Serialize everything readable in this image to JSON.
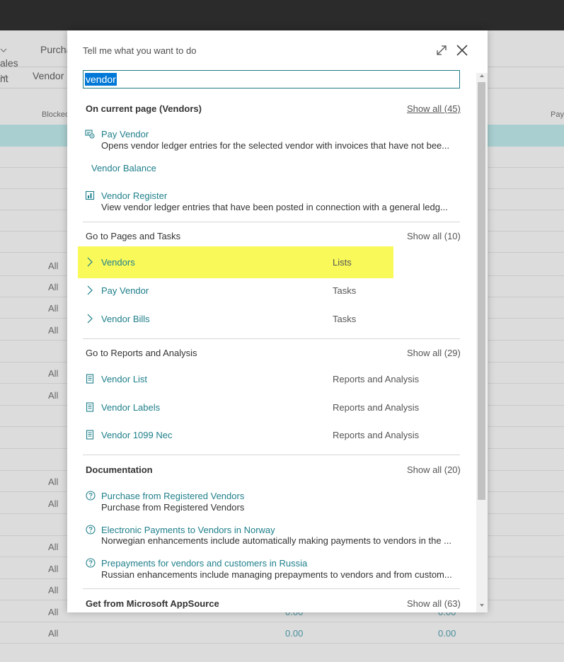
{
  "background": {
    "nav": [
      "ales",
      "Purcha"
    ],
    "actions": [
      "nt",
      "Vendor"
    ],
    "col_blocked": "Blocked",
    "col_payment": "Paym",
    "cell_all": "All",
    "amount_zero": "0.00"
  },
  "dialog": {
    "title": "Tell me what you want to do",
    "search_value": "vendor"
  },
  "sections": {
    "current_page": {
      "title": "On current page (Vendors)",
      "show_all": "Show all (45)",
      "items": [
        {
          "title": "Pay Vendor",
          "desc": "Opens vendor ledger entries for the selected vendor with invoices that have not bee..."
        },
        {
          "title": "Vendor Balance",
          "desc": ""
        },
        {
          "title": "Vendor Register",
          "desc": "View vendor ledger entries that have been posted in connection with a general ledg..."
        }
      ]
    },
    "pages_tasks": {
      "title": "Go to Pages and Tasks",
      "show_all": "Show all (10)",
      "items": [
        {
          "title": "Vendors",
          "category": "Lists"
        },
        {
          "title": "Pay Vendor",
          "category": "Tasks"
        },
        {
          "title": "Vendor Bills",
          "category": "Tasks"
        }
      ]
    },
    "reports": {
      "title": "Go to Reports and Analysis",
      "show_all": "Show all (29)",
      "items": [
        {
          "title": "Vendor List",
          "category": "Reports and Analysis"
        },
        {
          "title": "Vendor Labels",
          "category": "Reports and Analysis"
        },
        {
          "title": "Vendor 1099 Nec",
          "category": "Reports and Analysis"
        }
      ]
    },
    "documentation": {
      "title": "Documentation",
      "show_all": "Show all (20)",
      "items": [
        {
          "title": "Purchase from Registered Vendors",
          "desc": "Purchase from Registered Vendors"
        },
        {
          "title": "Electronic Payments to Vendors in Norway",
          "desc": "Norwegian enhancements include automatically making payments to vendors in the ..."
        },
        {
          "title": "Prepayments for vendors and customers in Russia",
          "desc": "Russian enhancements include managing prepayments to vendors and from custom..."
        }
      ]
    },
    "appsource": {
      "title": "Get from Microsoft AppSource",
      "show_all": "Show all (63)"
    }
  },
  "colors": {
    "accent": "#1e7f8a",
    "highlight": "#f9f95a",
    "selection": "#0078d7"
  },
  "icons": [
    "expand-icon",
    "close-icon",
    "action-icon",
    "report-icon",
    "chevron-right-icon",
    "document-icon",
    "help-icon"
  ]
}
